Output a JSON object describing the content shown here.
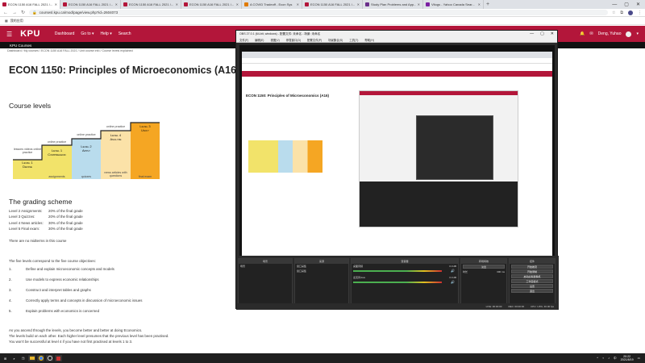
{
  "browser": {
    "tabs": [
      {
        "title": "ECON 1150 A16 FALL 2021 /..."
      },
      {
        "title": "ECON 1150 A16 FALL 2021 /..."
      },
      {
        "title": "ECON 1150 A16 FALL 2021 /..."
      },
      {
        "title": "ECON 1150 A16 FALL 2021 /..."
      },
      {
        "title": "A COVID Tradeoff - Econ Sys"
      },
      {
        "title": "ECON 1150 A16 FALL 2021 /..."
      },
      {
        "title": "Study Plan Problems and App..."
      },
      {
        "title": "Vltogs - Yahoo Canada Sear..."
      }
    ],
    "url": "coursesl.kpu.ca/mod/page/view.php?id=2604073",
    "bookmark": "我的应用"
  },
  "kpu": {
    "logo": "KPU",
    "nav": [
      "Dashboard",
      "Go to ▾",
      "Help ▾",
      "Search"
    ],
    "user": "Deng, Yuhao",
    "courses_bar": "KPU Courses",
    "breadcrumb": "Dashboard  /  My courses  /  ECON 1150 A16 FALL 2021  /  Unit course info  /  Course levels explained"
  },
  "page": {
    "title": "ECON 1150: Principles of Microeconomics (A16)",
    "course_levels_heading": "Course levels",
    "ladder": {
      "levels": [
        {
          "name": "Level 1",
          "verb": "Define",
          "color": "#f2e36a"
        },
        {
          "name": "Level 1",
          "verb": "Comprehend",
          "color": "#f2e36a"
        },
        {
          "name": "Level 2",
          "verb": "Apply",
          "color": "#b9dced"
        },
        {
          "name": "Level 4",
          "verb": "Analyze",
          "color": "#fbe2a8"
        },
        {
          "name": "Level 3",
          "verb": "Unify",
          "color": "#f5a623"
        }
      ],
      "top_labels": [
        "lessons videos online practice",
        "online practice",
        "online practice",
        "online practice"
      ],
      "bottom_labels": [
        "assignments",
        "quizzes",
        "news articles with questions",
        "final exam"
      ]
    },
    "grading_heading": "The grading scheme",
    "grades": [
      {
        "item": "Level 2 Assignments:",
        "weight": "20% of the final grade"
      },
      {
        "item": "Level 3 Quizzes:",
        "weight": "20% of the final grade"
      },
      {
        "item": "Level 4 News articles:",
        "weight": "30% of the final grade"
      },
      {
        "item": "Level 5 Final exam:",
        "weight": "30% of the final grade"
      }
    ],
    "no_midterms": "There are no midterms in this course",
    "objectives_intro": "The five levels correspond to the five course objectives:",
    "objectives": [
      {
        "n": "1.",
        "text": "Define and explain microeconomic concepts and models"
      },
      {
        "n": "2.",
        "text": "Use models to express economic relationships"
      },
      {
        "n": "3.",
        "text": "Construct and interpret tables and graphs"
      },
      {
        "n": "4.",
        "text": "Correctly apply terms and concepts in discussion of microeconomic issues"
      },
      {
        "n": "5.",
        "text": "Explain problems with economics is concerned"
      }
    ],
    "closing": [
      "As you ascend through the levels, you become better and better at doing Economics.",
      "The levels build on each other. Each higher level presumes that the previous level has been practised.",
      "You won't be successful at level 4 if you have not first practised at levels 1 to 3."
    ]
  },
  "obs": {
    "title": "OBS 27.0.1 (64-bit, windows) - 配置文件: 未命名 - 场景: 未命名",
    "menu": [
      "文件(F)",
      "编辑(E)",
      "视图(V)",
      "停靠窗口(D)",
      "配置文件(P)",
      "场景集合(S)",
      "工具(T)",
      "帮助(H)"
    ],
    "preview_title": "ECON 1150: Principles of Microeconomics (A16)",
    "docks": {
      "scenes": {
        "header": "场景",
        "item": "场景"
      },
      "sources": {
        "header": "来源",
        "items": [
          "窗口采集",
          "窗口采集"
        ]
      },
      "mixer": {
        "header": "混音器",
        "channels": [
          {
            "name": "桌面音频",
            "db": "0.0 dB"
          },
          {
            "name": "麦克风/Aux",
            "db": "0.0 dB"
          }
        ]
      },
      "transitions": {
        "header": "转场特效",
        "type": "淡出",
        "duration_label": "时长",
        "duration": "300 ms"
      },
      "controls": {
        "header": "控件",
        "buttons": [
          "开始推流",
          "开始录制",
          "启动虚拟摄像机",
          "工作室模式",
          "设置",
          "退出"
        ]
      }
    },
    "status": {
      "live": "LIVE: 00:00:00",
      "rec": "REC: 00:00:00",
      "cpu": "CPU: 1.8%, 30.00 fps"
    }
  },
  "taskbar": {
    "time": "20:22",
    "date": "2021/8/19",
    "lang": "中"
  }
}
